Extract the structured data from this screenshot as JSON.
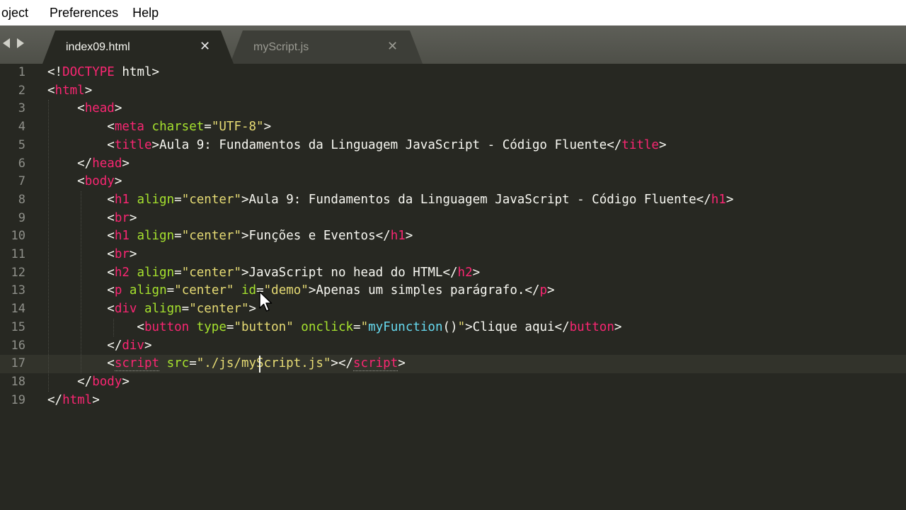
{
  "menu": {
    "items": [
      "oject",
      "Preferences",
      "Help"
    ]
  },
  "tabs": [
    {
      "label": "index09.html",
      "active": true
    },
    {
      "label": "myScript.js",
      "active": false
    }
  ],
  "editor": {
    "current_line": 17,
    "line_numbers": [
      "1",
      "2",
      "3",
      "4",
      "5",
      "6",
      "7",
      "8",
      "9",
      "10",
      "11",
      "12",
      "13",
      "14",
      "15",
      "16",
      "17",
      "18",
      "19"
    ],
    "lines": [
      [
        [
          "p",
          "<!"
        ],
        [
          "tag",
          "DOCTYPE"
        ],
        [
          "p",
          " html>"
        ]
      ],
      [
        [
          "p",
          "<"
        ],
        [
          "tag",
          "html"
        ],
        [
          "p",
          ">"
        ]
      ],
      [
        [
          "p",
          "    <"
        ],
        [
          "tag",
          "head"
        ],
        [
          "p",
          ">"
        ]
      ],
      [
        [
          "p",
          "        <"
        ],
        [
          "tag",
          "meta"
        ],
        [
          "p",
          " "
        ],
        [
          "attr",
          "charset"
        ],
        [
          "p",
          "="
        ],
        [
          "str",
          "\"UTF-8\""
        ],
        [
          "p",
          ">"
        ]
      ],
      [
        [
          "p",
          "        <"
        ],
        [
          "tag",
          "title"
        ],
        [
          "p",
          ">Aula 9: Fundamentos da Linguagem JavaScript - Código Fluente</"
        ],
        [
          "tag",
          "title"
        ],
        [
          "p",
          ">"
        ]
      ],
      [
        [
          "p",
          "    </"
        ],
        [
          "tag",
          "head"
        ],
        [
          "p",
          ">"
        ]
      ],
      [
        [
          "p",
          "    <"
        ],
        [
          "tag",
          "body"
        ],
        [
          "p",
          ">"
        ]
      ],
      [
        [
          "p",
          "        <"
        ],
        [
          "tag",
          "h1"
        ],
        [
          "p",
          " "
        ],
        [
          "attr",
          "align"
        ],
        [
          "p",
          "="
        ],
        [
          "str",
          "\"center\""
        ],
        [
          "p",
          ">Aula 9: Fundamentos da Linguagem JavaScript - Código Fluente</"
        ],
        [
          "tag",
          "h1"
        ],
        [
          "p",
          ">"
        ]
      ],
      [
        [
          "p",
          "        <"
        ],
        [
          "tag",
          "br"
        ],
        [
          "p",
          ">"
        ]
      ],
      [
        [
          "p",
          "        <"
        ],
        [
          "tag",
          "h1"
        ],
        [
          "p",
          " "
        ],
        [
          "attr",
          "align"
        ],
        [
          "p",
          "="
        ],
        [
          "str",
          "\"center\""
        ],
        [
          "p",
          ">Funções e Eventos</"
        ],
        [
          "tag",
          "h1"
        ],
        [
          "p",
          ">"
        ]
      ],
      [
        [
          "p",
          "        <"
        ],
        [
          "tag",
          "br"
        ],
        [
          "p",
          ">"
        ]
      ],
      [
        [
          "p",
          "        <"
        ],
        [
          "tag",
          "h2"
        ],
        [
          "p",
          " "
        ],
        [
          "attr",
          "align"
        ],
        [
          "p",
          "="
        ],
        [
          "str",
          "\"center\""
        ],
        [
          "p",
          ">JavaScript no head do HTML</"
        ],
        [
          "tag",
          "h2"
        ],
        [
          "p",
          ">"
        ]
      ],
      [
        [
          "p",
          "        <"
        ],
        [
          "tag",
          "p"
        ],
        [
          "p",
          " "
        ],
        [
          "attr",
          "align"
        ],
        [
          "p",
          "="
        ],
        [
          "str",
          "\"center\""
        ],
        [
          "p",
          " "
        ],
        [
          "attr",
          "id"
        ],
        [
          "p",
          "="
        ],
        [
          "str",
          "\"demo\""
        ],
        [
          "p",
          ">Apenas um simples parágrafo.</"
        ],
        [
          "tag",
          "p"
        ],
        [
          "p",
          ">"
        ]
      ],
      [
        [
          "p",
          "        <"
        ],
        [
          "tag",
          "div"
        ],
        [
          "p",
          " "
        ],
        [
          "attr",
          "align"
        ],
        [
          "p",
          "="
        ],
        [
          "str",
          "\"center\""
        ],
        [
          "p",
          ">"
        ]
      ],
      [
        [
          "p",
          "            <"
        ],
        [
          "tag",
          "button"
        ],
        [
          "p",
          " "
        ],
        [
          "attr",
          "type"
        ],
        [
          "p",
          "="
        ],
        [
          "str",
          "\"button\""
        ],
        [
          "p",
          " "
        ],
        [
          "attr",
          "onclick"
        ],
        [
          "p",
          "="
        ],
        [
          "str",
          "\""
        ],
        [
          "fn",
          "myFunction"
        ],
        [
          "p",
          "()"
        ],
        [
          "str",
          "\""
        ],
        [
          "p",
          ">Clique aqui</"
        ],
        [
          "tag",
          "button"
        ],
        [
          "p",
          ">"
        ]
      ],
      [
        [
          "p",
          "        </"
        ],
        [
          "tag",
          "div"
        ],
        [
          "p",
          ">"
        ]
      ],
      [
        [
          "p",
          "        <"
        ],
        [
          "tagd",
          "script"
        ],
        [
          "p",
          " "
        ],
        [
          "attr",
          "src"
        ],
        [
          "p",
          "="
        ],
        [
          "str",
          "\"./js/myScript.js\""
        ],
        [
          "p",
          "></"
        ],
        [
          "tagd",
          "script"
        ],
        [
          "p",
          ">"
        ]
      ],
      [
        [
          "p",
          "    </"
        ],
        [
          "tag",
          "body"
        ],
        [
          "p",
          ">"
        ]
      ],
      [
        [
          "p",
          "</"
        ],
        [
          "tag",
          "html"
        ],
        [
          "p",
          ">"
        ]
      ]
    ]
  }
}
